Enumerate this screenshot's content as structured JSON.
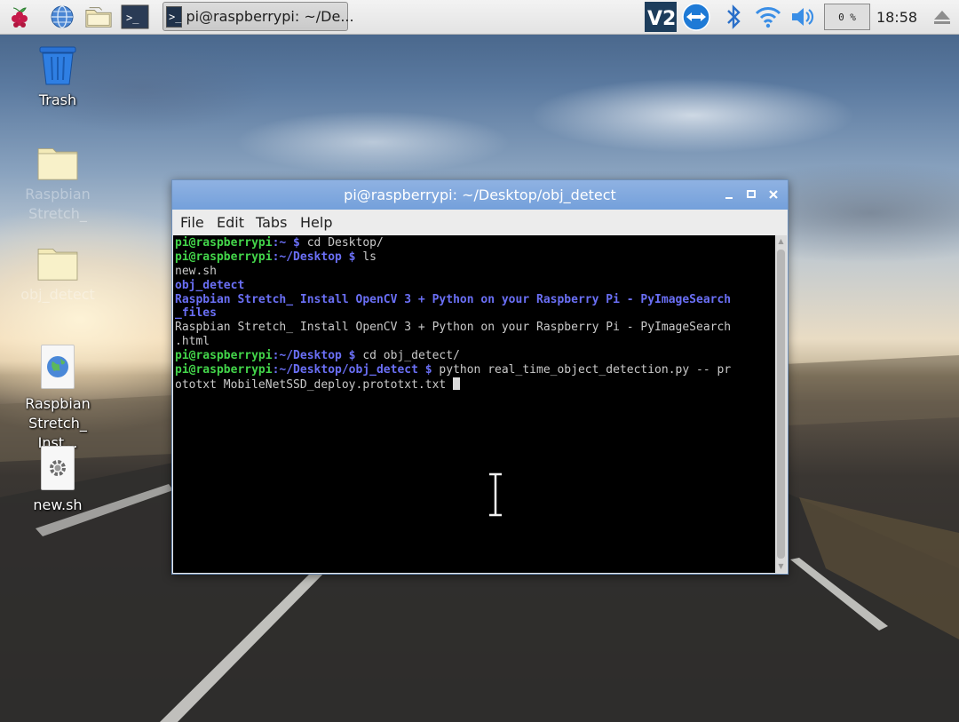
{
  "taskbar": {
    "launchers": [
      {
        "name": "raspberry-menu",
        "icon": "raspberry-icon"
      },
      {
        "name": "web-browser",
        "icon": "globe-icon"
      },
      {
        "name": "file-manager",
        "icon": "folder-icon"
      },
      {
        "name": "terminal",
        "icon": "terminal-icon"
      }
    ],
    "task_button_label": "pi@raspberrypi: ~/De...",
    "tray": {
      "vnc_label": "V2",
      "cpu_usage": "0 %",
      "clock": "18:58"
    }
  },
  "desktop": {
    "icons": [
      {
        "label": "Trash",
        "type": "trash"
      },
      {
        "label": "Raspbian Stretch_",
        "type": "folder"
      },
      {
        "label": "obj_detect",
        "type": "folder"
      },
      {
        "label_line1": "Raspbian",
        "label_line2": "Stretch_ Inst...",
        "type": "html-file"
      },
      {
        "label": "new.sh",
        "type": "script-file"
      }
    ]
  },
  "terminal": {
    "title": "pi@raspberrypi: ~/Desktop/obj_detect",
    "menu": [
      "File",
      "Edit",
      "Tabs",
      "Help"
    ],
    "lines": [
      {
        "user": "pi@raspberrypi",
        "path": ":~ $",
        "cmd": " cd Desktop/"
      },
      {
        "user": "pi@raspberrypi",
        "path": ":~/Desktop $",
        "cmd": " ls"
      },
      {
        "text": "new.sh"
      },
      {
        "dir": "obj_detect"
      },
      {
        "dir": "Raspbian Stretch_ Install OpenCV 3 + Python on your Raspberry Pi - PyImageSearch"
      },
      {
        "dir": "_files"
      },
      {
        "text": "Raspbian Stretch_ Install OpenCV 3 + Python on your Raspberry Pi - PyImageSearch"
      },
      {
        "text": ".html"
      },
      {
        "user": "pi@raspberrypi",
        "path": ":~/Desktop $",
        "cmd": " cd obj_detect/"
      },
      {
        "user": "pi@raspberrypi",
        "path": ":~/Desktop/obj_detect $",
        "cmd": " python real_time_object_detection.py -- pr"
      },
      {
        "text": "ototxt MobileNetSSD_deploy.prototxt.txt ",
        "cursor": true
      }
    ]
  },
  "colors": {
    "panel_bg": "#e8e8e8",
    "titlebar": "#7ea6dd",
    "prompt_user": "#43d54a",
    "prompt_path": "#6a6ff5",
    "terminal_bg": "#000000",
    "terminal_text": "#c9c9c9"
  }
}
